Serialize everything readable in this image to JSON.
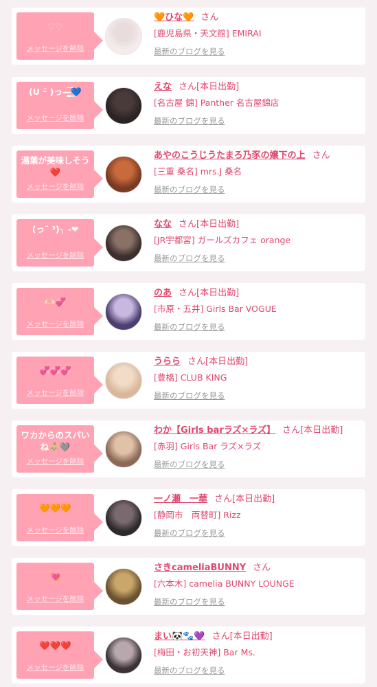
{
  "delete_label": "メッセージを削除",
  "blog_label": "最新のブログを見る",
  "honorific": "さん",
  "cards": [
    {
      "message": "♡♡",
      "message_faint": true,
      "name": "🧡ひな🧡",
      "status": "",
      "shop": "[鹿児島県・天文館] EMIRAI",
      "avatar_colors": [
        "#f4ecec",
        "#e9dcdc"
      ]
    },
    {
      "message": "(U ᵕ̈ )っ—̳͟͞͞💙",
      "message_faint": false,
      "name": "えな",
      "status": "[本日出勤]",
      "shop": "[名古屋 錦] Panther 名古屋錦店",
      "avatar_colors": [
        "#2a2424",
        "#4a3b3b"
      ]
    },
    {
      "message": "湯葉が美味しそう❤️",
      "message_faint": false,
      "name": "あやのこうじうたまろ乃豕の嬢下の上",
      "status": "",
      "shop": "[三重 桑名] mrs.J 桑名",
      "avatar_colors": [
        "#7a3a22",
        "#c96a3c"
      ]
    },
    {
      "message": "(っ˘ ³)╮ -❤",
      "message_faint": false,
      "name": "なな",
      "status": "[本日出勤]",
      "shop": "[JR宇都宮] ガールズカフェ orange",
      "avatar_colors": [
        "#3b2f2c",
        "#8a7067"
      ]
    },
    {
      "message": "🫶🏻💞",
      "message_faint": false,
      "name": "のあ",
      "status": "[本日出勤]",
      "shop": "[市原・五井] Girls Bar VOGUE",
      "avatar_colors": [
        "#4b3f6e",
        "#c8b8e0"
      ]
    },
    {
      "message": "💞💞💞",
      "message_faint": false,
      "name": "うらら",
      "status": "[本日出勤]",
      "shop": "[豊橋] CLUB KING",
      "avatar_colors": [
        "#d9b79a",
        "#f2dcc8"
      ]
    },
    {
      "message": "ワカからのスパいね👶🏼🩶",
      "message_faint": false,
      "name": "わか【Girls barラズ×ラズ】",
      "status": "[本日出勤]",
      "shop": "[赤羽] Girls Bar ラズ×ラズ",
      "avatar_colors": [
        "#8c6a58",
        "#e0c2a8"
      ]
    },
    {
      "message": "🧡🧡🧡",
      "message_faint": false,
      "name": "一ノ瀬　一華",
      "status": "[本日出勤]",
      "shop": "[静岡市　両替町] Rizz",
      "avatar_colors": [
        "#2e2a2c",
        "#7a6a70"
      ]
    },
    {
      "message": "💘",
      "message_faint": false,
      "name": "さきcameliaBUNNY",
      "status": "",
      "shop": "[六本木] camelia BUNNY LOUNGE",
      "avatar_colors": [
        "#6a5230",
        "#c9a66a"
      ]
    },
    {
      "message": "❤️❤️❤️",
      "message_faint": false,
      "name": "まい🐼🐾💜",
      "status": "[本日出勤]",
      "shop": "[梅田・お初天神] Bar Ms.",
      "avatar_colors": [
        "#3a3236",
        "#b8a8ae"
      ]
    }
  ]
}
